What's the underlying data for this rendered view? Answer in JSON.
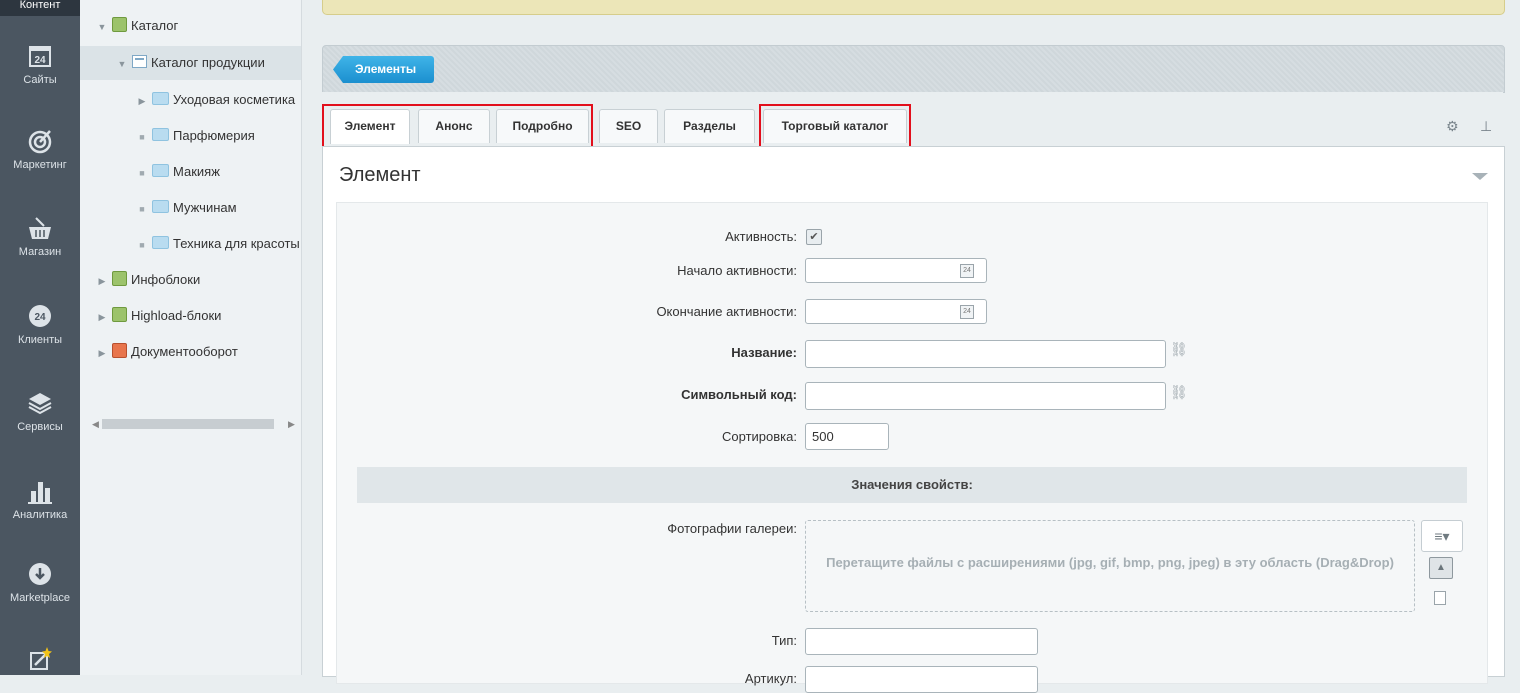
{
  "rail": {
    "active_label": "Контент",
    "items": [
      {
        "label": "Сайты",
        "icon": "calendar-24-icon"
      },
      {
        "label": "Маркетинг",
        "icon": "target-icon"
      },
      {
        "label": "Магазин",
        "icon": "basket-icon"
      },
      {
        "label": "Клиенты",
        "icon": "clients-24-icon"
      },
      {
        "label": "Сервисы",
        "icon": "layers-icon"
      },
      {
        "label": "Аналитика",
        "icon": "bar-chart-icon"
      },
      {
        "label": "Marketplace",
        "icon": "cloud-download-icon"
      },
      {
        "label": "",
        "icon": "magic-wand-icon"
      }
    ]
  },
  "tree": {
    "items": [
      {
        "label": "Каталог"
      },
      {
        "label": "Каталог продукции"
      },
      {
        "label": "Уходовая косметика"
      },
      {
        "label": "Парфюмерия"
      },
      {
        "label": "Макияж"
      },
      {
        "label": "Мужчинам"
      },
      {
        "label": "Техника для красоты"
      },
      {
        "label": "Инфоблоки"
      },
      {
        "label": "Highload-блоки"
      },
      {
        "label": "Документооборот"
      }
    ]
  },
  "toolbar": {
    "elements_button": "Элементы"
  },
  "tabs": [
    {
      "label": "Элемент"
    },
    {
      "label": "Анонс"
    },
    {
      "label": "Подробно"
    },
    {
      "label": "SEO"
    },
    {
      "label": "Разделы"
    },
    {
      "label": "Торговый каталог"
    }
  ],
  "section": {
    "title": "Элемент"
  },
  "form": {
    "active_label": "Активность:",
    "active_checked": true,
    "start_label": "Начало активности:",
    "end_label": "Окончание активности:",
    "name_label": "Название:",
    "code_label": "Символьный код:",
    "sort_label": "Сортировка:",
    "sort_value": "500",
    "props_header": "Значения свойств:",
    "gallery_label": "Фотографии галереи:",
    "dropzone_text": "Перетащите файлы с расширениями (jpg, gif, bmp, png, jpeg) в эту область (Drag&Drop)",
    "type_label": "Тип:",
    "article_label": "Артикул:"
  },
  "colors": {
    "accent": "#1b8fcf",
    "highlight": "#e20f1c",
    "rail": "#4b5661"
  }
}
